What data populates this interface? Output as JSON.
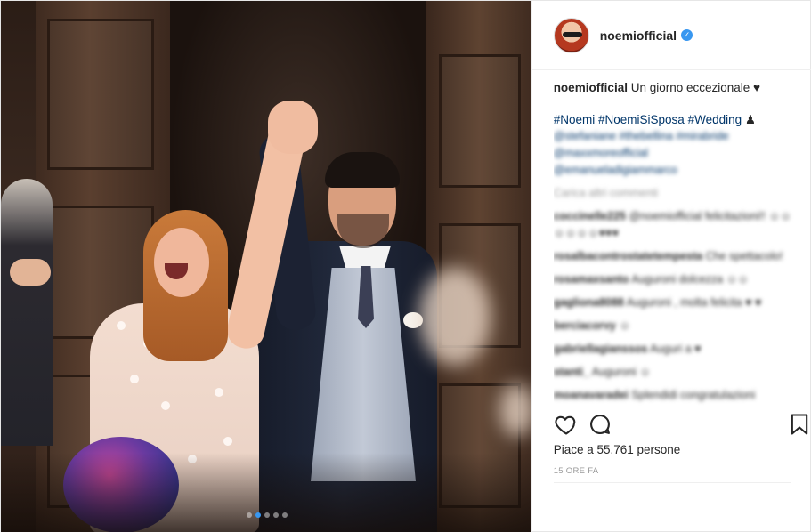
{
  "post": {
    "username": "noemiofficial",
    "verified": true,
    "caption_author": "noemiofficial",
    "caption_text": "Un giorno eccezionale ♥",
    "hashtags": [
      "#Noemi",
      "#NoemiSiSposa",
      "#Wedding"
    ],
    "hashtags_suffix": "♟",
    "blurred_tag_lines": [
      "@stefaniane #thebellina #mirabride",
      "@maxxmoreofficial",
      "@emanueladigiammarco"
    ],
    "load_more": "Carica altri commenti",
    "comments": [
      {
        "user": "coccinelle225",
        "text": "@noemiofficial felicitazioni!! ☺☺☺☺☺☺♥♥♥"
      },
      {
        "user": "rosalbacontrostatetempesta",
        "text": "Che spettacolo!"
      },
      {
        "user": "rosamaxsanto",
        "text": "Auguroni dolcezza ☺☺"
      },
      {
        "user": "gagliona8088",
        "text": "Auguroni , molta felicita ♥ ♥"
      },
      {
        "user": "berciacorvy",
        "text": "☺"
      },
      {
        "user": "gabriellagianssos",
        "text": "Auguri a ♥"
      },
      {
        "user": "stanti_",
        "text": "Auguroni ☺"
      },
      {
        "user": "moanavaradei",
        "text": "Splendidi congratulazioni"
      }
    ],
    "likes_text": "Piace a 55.761 persone",
    "time_ago": "15 ORE FA",
    "carousel": {
      "count": 5,
      "active": 1
    }
  },
  "icons": {
    "like": "heart-outline-icon",
    "comment": "speech-bubble-icon",
    "save": "bookmark-icon",
    "verified": "verified-badge-icon"
  },
  "colors": {
    "accent_blue": "#3897f0",
    "link": "#003569",
    "muted": "#999999",
    "text": "#262626"
  }
}
